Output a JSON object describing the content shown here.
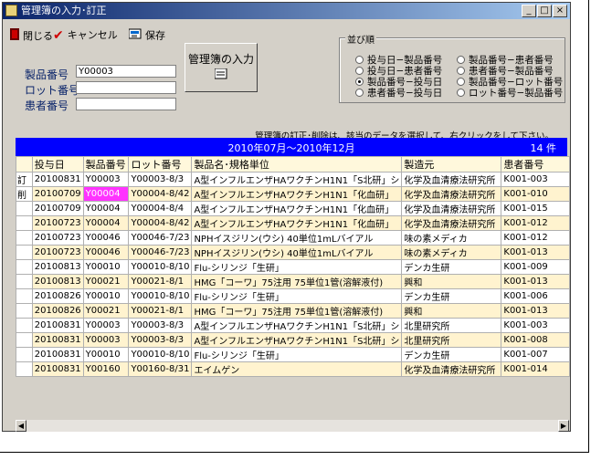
{
  "window": {
    "title": "管理簿の入力･訂正"
  },
  "titlebar_buttons": {
    "minimize": "_",
    "maximize": "□",
    "close": "×"
  },
  "toolbar": {
    "close_label": "閉じる",
    "cancel_label": "キャンセル",
    "save_label": "保存"
  },
  "form": {
    "product_label": "製品番号",
    "product_value": "Y00003",
    "lot_label": "ロット番号",
    "lot_value": "",
    "patient_label": "患者番号",
    "patient_value": ""
  },
  "input_button": {
    "label": "管理簿の入力"
  },
  "sort": {
    "legend": "並び順",
    "options": [
      {
        "label": "投与日−製品番号",
        "selected": false
      },
      {
        "label": "製品番号−患者番号",
        "selected": false
      },
      {
        "label": "投与日−患者番号",
        "selected": false
      },
      {
        "label": "患者番号−製品番号",
        "selected": false
      },
      {
        "label": "製品番号−投与日",
        "selected": true
      },
      {
        "label": "製品番号−ロット番号",
        "selected": false
      },
      {
        "label": "患者番号−投与日",
        "selected": false
      },
      {
        "label": "ロット番号−製品番号",
        "selected": false
      }
    ]
  },
  "note": "管理簿の訂正･削除は、該当のデータを選択して、右クリックをして下さい。",
  "header_bar": {
    "period": "2010年07月〜2010年12月",
    "count": "14 件"
  },
  "table": {
    "columns": [
      "投与日",
      "製品番号",
      "ロット番号",
      "製品名･規格単位",
      "製造元",
      "患者番号"
    ],
    "rows": [
      {
        "mark": "訂",
        "date": "20100831",
        "product": "Y00003",
        "lot": "Y00003-8/3",
        "name": "A型インフルエンザHAワクチンH1N1「S北研」シ",
        "maker": "化学及血清療法研究所",
        "patient": "K001-003"
      },
      {
        "mark": "削",
        "date": "20100709",
        "product": "Y00004",
        "lot": "Y00004-8/42",
        "name": "A型インフルエンザHAワクチンH1N1「化血研」",
        "maker": "化学及血清療法研究所",
        "patient": "K001-010"
      },
      {
        "mark": "",
        "date": "20100709",
        "product": "Y00004",
        "lot": "Y00004-8/4",
        "name": "A型インフルエンザHAワクチンH1N1「化血研」",
        "maker": "化学及血清療法研究所",
        "patient": "K001-015"
      },
      {
        "mark": "",
        "date": "20100723",
        "product": "Y00004",
        "lot": "Y00004-8/42",
        "name": "A型インフルエンザHAワクチンH1N1「化血研」",
        "maker": "化学及血清療法研究所",
        "patient": "K001-012"
      },
      {
        "mark": "",
        "date": "20100723",
        "product": "Y00046",
        "lot": "Y00046-7/23",
        "name": "NPHイスジリン(ウシ) 40単位1mLバイアル",
        "maker": "味の素メディカ",
        "patient": "K001-012"
      },
      {
        "mark": "",
        "date": "20100723",
        "product": "Y00046",
        "lot": "Y00046-7/23",
        "name": "NPHイスジリン(ウシ) 40単位1mLバイアル",
        "maker": "味の素メディカ",
        "patient": "K001-013"
      },
      {
        "mark": "",
        "date": "20100813",
        "product": "Y00010",
        "lot": "Y00010-8/10",
        "name": "Flu-シリンジ「生研」",
        "maker": "デンカ生研",
        "patient": "K001-009"
      },
      {
        "mark": "",
        "date": "20100813",
        "product": "Y00021",
        "lot": "Y00021-8/1",
        "name": "HMG「コーワ」75注用 75単位1管(溶解液付)",
        "maker": "興和",
        "patient": "K001-013"
      },
      {
        "mark": "",
        "date": "20100826",
        "product": "Y00010",
        "lot": "Y00010-8/10",
        "name": "Flu-シリンジ「生研」",
        "maker": "デンカ生研",
        "patient": "K001-006"
      },
      {
        "mark": "",
        "date": "20100826",
        "product": "Y00021",
        "lot": "Y00021-8/1",
        "name": "HMG「コーワ」75注用 75単位1管(溶解液付)",
        "maker": "興和",
        "patient": "K001-013"
      },
      {
        "mark": "",
        "date": "20100831",
        "product": "Y00003",
        "lot": "Y00003-8/3",
        "name": "A型インフルエンザHAワクチンH1N1「S北研」シ",
        "maker": "北里研究所",
        "patient": "K001-003"
      },
      {
        "mark": "",
        "date": "20100831",
        "product": "Y00003",
        "lot": "Y00003-8/3",
        "name": "A型インフルエンザHAワクチンH1N1「S北研」シ",
        "maker": "北里研究所",
        "patient": "K001-008"
      },
      {
        "mark": "",
        "date": "20100831",
        "product": "Y00010",
        "lot": "Y00010-8/10",
        "name": "Flu-シリンジ「生研」",
        "maker": "デンカ生研",
        "patient": "K001-007"
      },
      {
        "mark": "",
        "date": "20100831",
        "product": "Y00160",
        "lot": "Y00160-8/31",
        "name": "エイムゲン",
        "maker": "化学及血清療法研究所",
        "patient": "K001-014"
      }
    ]
  },
  "colors": {
    "header_bar": "#0000ff",
    "selected_cell": "#ff33ff",
    "row_alt": "#fff3cf",
    "title_gradient_start": "#0a246a"
  }
}
